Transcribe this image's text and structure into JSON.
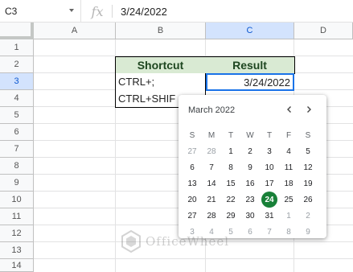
{
  "formula_bar": {
    "cell_ref": "C3",
    "fx_label": "fx",
    "value": "3/24/2022"
  },
  "columns": [
    "A",
    "B",
    "C",
    "D"
  ],
  "rows": [
    "1",
    "2",
    "3",
    "4",
    "5",
    "6",
    "7",
    "8",
    "9",
    "10",
    "11",
    "12",
    "13",
    "14"
  ],
  "selected": {
    "column": "C",
    "row": "3"
  },
  "table": {
    "header_shortcut": "Shortcut",
    "header_result": "Result",
    "row1_shortcut": "CTRL+;",
    "row1_result": "3/24/2022",
    "row2_shortcut": "CTRL+SHIF"
  },
  "colors": {
    "header_fill": "#d9ead3",
    "header_text": "#1e4620",
    "selection": "#1a73e8",
    "today": "#188038"
  },
  "date_picker": {
    "title": "March 2022",
    "prev_icon": "chevron-left-icon",
    "next_icon": "chevron-right-icon",
    "weekdays": [
      "S",
      "M",
      "T",
      "W",
      "T",
      "F",
      "S"
    ],
    "weeks": [
      [
        "27",
        "28",
        "1",
        "2",
        "3",
        "4",
        "5"
      ],
      [
        "6",
        "7",
        "8",
        "9",
        "10",
        "11",
        "12"
      ],
      [
        "13",
        "14",
        "15",
        "16",
        "17",
        "18",
        "19"
      ],
      [
        "20",
        "21",
        "22",
        "23",
        "24",
        "25",
        "26"
      ],
      [
        "27",
        "28",
        "29",
        "30",
        "31",
        "1",
        "2"
      ],
      [
        "3",
        "4",
        "5",
        "6",
        "7",
        "8",
        "9"
      ]
    ],
    "today": "24"
  },
  "watermark": {
    "text": "OfficeWheel",
    "icon": "officewheel-logo-icon"
  }
}
